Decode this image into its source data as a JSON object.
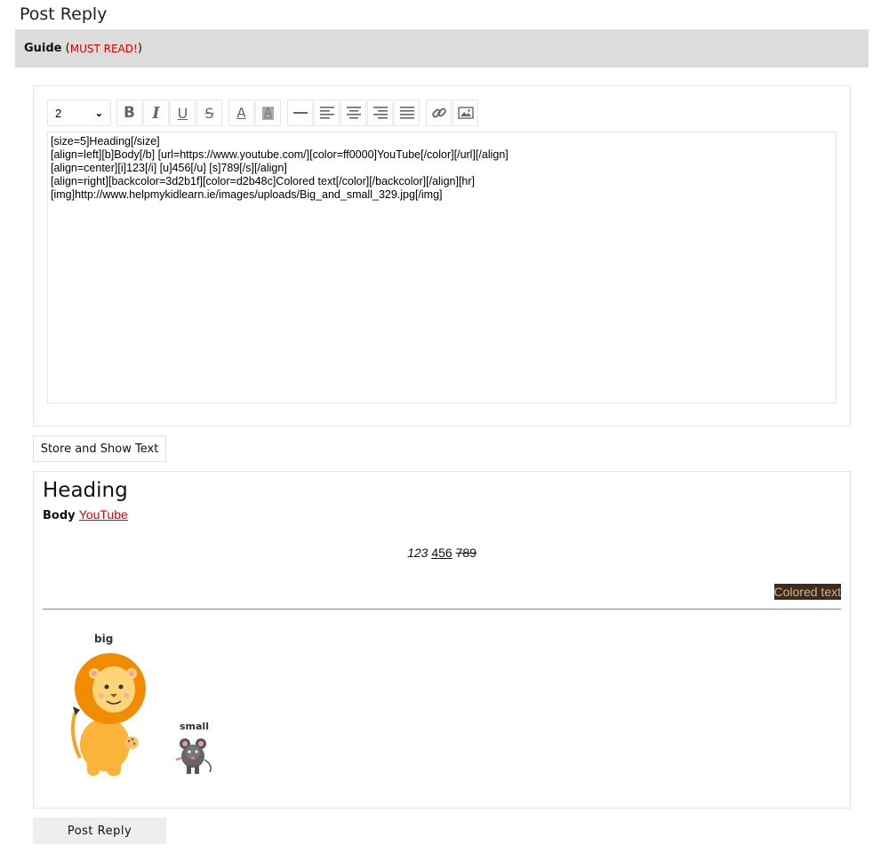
{
  "page": {
    "title": "Post Reply"
  },
  "guide": {
    "label": "Guide",
    "open_paren": "(",
    "link": "MUST READ!",
    "close_paren": ")"
  },
  "toolbar": {
    "size_value": "2",
    "buttons": [
      {
        "name": "bold-icon",
        "glyph": "B"
      },
      {
        "name": "italic-icon",
        "glyph": "I"
      },
      {
        "name": "underline-icon",
        "glyph": "U"
      },
      {
        "name": "strikethrough-icon",
        "glyph": "S"
      },
      {
        "name": "font-color-icon",
        "glyph": "A"
      },
      {
        "name": "background-color-icon",
        "glyph": "A"
      },
      {
        "name": "horizontal-rule-icon"
      },
      {
        "name": "align-left-icon"
      },
      {
        "name": "align-center-icon"
      },
      {
        "name": "align-right-icon"
      },
      {
        "name": "justify-icon"
      },
      {
        "name": "link-icon"
      },
      {
        "name": "image-icon"
      }
    ]
  },
  "editor": {
    "text": "[size=5]Heading[/size]\n[align=left][b]Body[/b] [url=https://www.youtube.com/][color=ff0000]YouTube[/color][/url][/align]\n[align=center][i]123[/i] [u]456[/u] [s]789[/s][/align]\n[align=right][backcolor=3d2b1f][color=d2b48c]Colored text[/color][/backcolor][/align][hr]\n[img]http://www.helpmykidlearn.ie/images/uploads/Big_and_small_329.jpg[/img]"
  },
  "store_button": {
    "label": "Store and Show Text"
  },
  "preview": {
    "heading": "Heading",
    "body_bold": "Body",
    "link_text": "YouTube",
    "italic": "123",
    "underline": "456",
    "strike": "789",
    "colored_text": "Colored text",
    "image": {
      "label_big": "big",
      "label_small": "small"
    }
  },
  "colors": {
    "link_red": "#ff0000",
    "backcolor": "#3d2b1f",
    "textcolor": "#d2b48c",
    "guide_bg": "#dcdcdc"
  },
  "post_button": {
    "label": "Post Reply"
  }
}
